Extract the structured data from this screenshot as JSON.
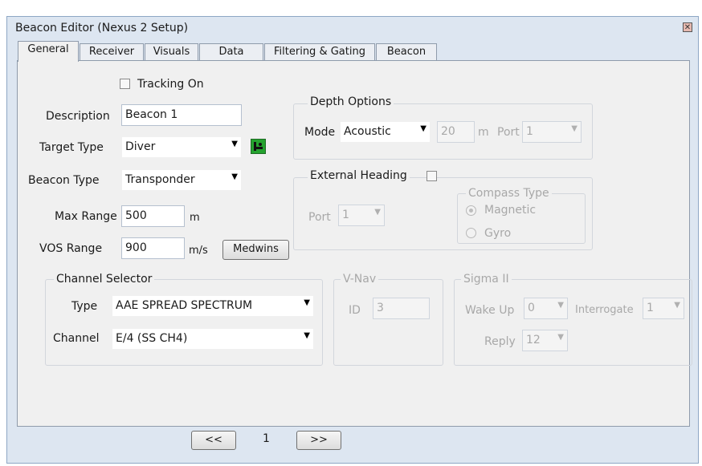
{
  "window": {
    "title": "Beacon Editor (Nexus 2 Setup)"
  },
  "tabs": [
    "General",
    "Receiver",
    "Visuals",
    "Data",
    "Filtering & Gating",
    "Beacon"
  ],
  "general": {
    "tracking_on_label": "Tracking On",
    "description_label": "Description",
    "description_value": "Beacon 1",
    "target_type_label": "Target Type",
    "target_type_value": "Diver",
    "beacon_type_label": "Beacon Type",
    "beacon_type_value": "Transponder",
    "max_range_label": "Max Range",
    "max_range_value": "500",
    "max_range_unit": "m",
    "vos_range_label": "VOS Range",
    "vos_range_value": "900",
    "vos_range_unit": "m/s",
    "medwins_label": "Medwins"
  },
  "depth_options": {
    "title": "Depth Options",
    "mode_label": "Mode",
    "mode_value": "Acoustic",
    "depth_value": "20",
    "depth_unit": "m",
    "port_label": "Port",
    "port_value": "1"
  },
  "external_heading": {
    "title": "External Heading",
    "port_label": "Port",
    "port_value": "1",
    "compass_type_title": "Compass Type",
    "magnetic_label": "Magnetic",
    "gyro_label": "Gyro"
  },
  "channel_selector": {
    "title": "Channel Selector",
    "type_label": "Type",
    "type_value": "AAE SPREAD SPECTRUM",
    "channel_label": "Channel",
    "channel_value": "E/4 (SS CH4)"
  },
  "vnav": {
    "title": "V-Nav",
    "id_label": "ID",
    "id_value": "3"
  },
  "sigma": {
    "title": "Sigma II",
    "wake_up_label": "Wake Up",
    "wake_up_value": "0",
    "interrogate_label": "Interrogate",
    "interrogate_value": "1",
    "reply_label": "Reply",
    "reply_value": "12"
  },
  "pager": {
    "prev_label": "<<",
    "page": "1",
    "next_label": ">>"
  },
  "icons": {
    "close": "close-icon",
    "diver": "diver-icon",
    "dropdown": "chevron-down-icon"
  }
}
